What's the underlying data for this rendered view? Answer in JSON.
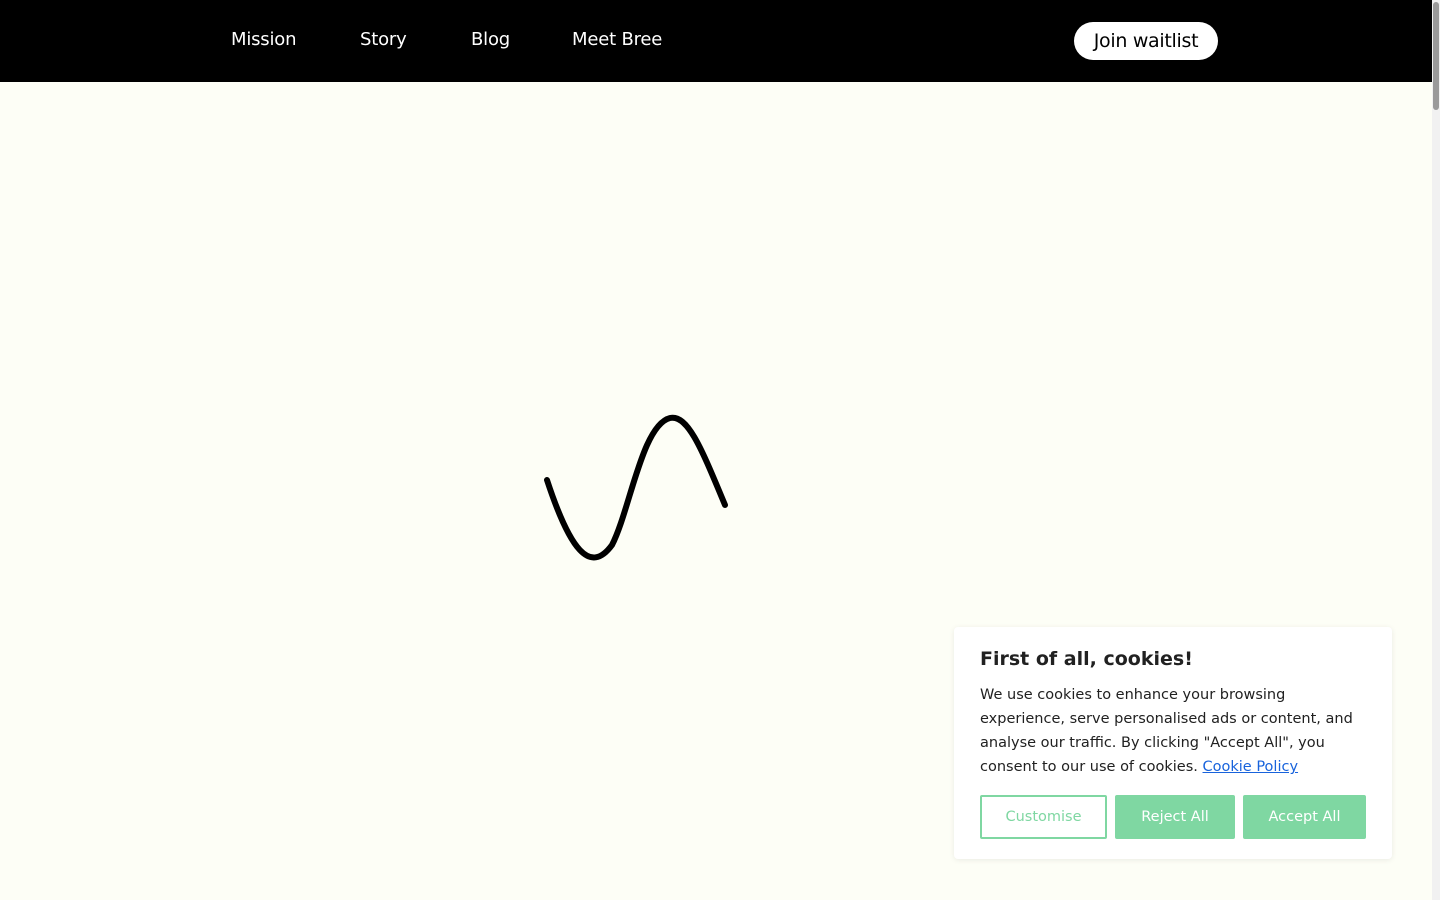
{
  "nav": {
    "items": [
      {
        "label": "Mission"
      },
      {
        "label": "Story"
      },
      {
        "label": "Blog"
      },
      {
        "label": "Meet Bree"
      }
    ],
    "cta_label": "Join waitlist"
  },
  "hero": {
    "icon": "wave-icon"
  },
  "cookie_banner": {
    "title": "First of all, cookies!",
    "body": "We use cookies to enhance your browsing experience, serve personalised ads or content, and analyse our traffic. By clicking \"Accept All\", you consent to our use of cookies.",
    "policy_link": "Cookie Policy",
    "buttons": {
      "customise": "Customise",
      "reject": "Reject All",
      "accept": "Accept All"
    }
  },
  "colors": {
    "background": "#fdfef6",
    "nav_bg": "#000000",
    "accent": "#7fd7a2",
    "link": "#1863dc"
  }
}
